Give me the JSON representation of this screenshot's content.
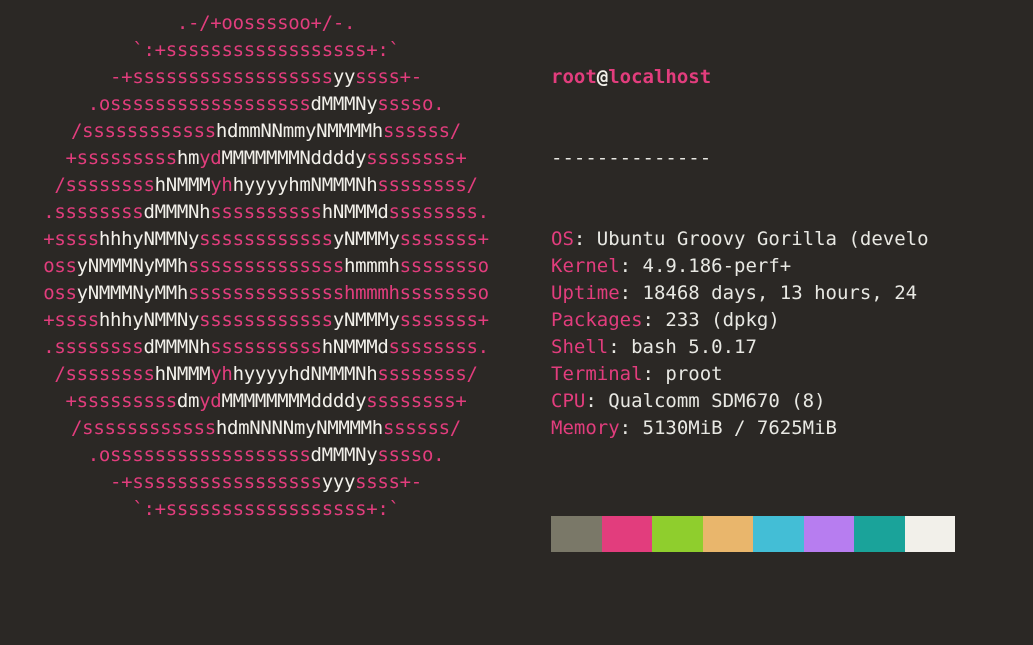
{
  "prompt": {
    "user": "root",
    "at": "@",
    "host": "localhost"
  },
  "divider": "--------------",
  "info": [
    {
      "label": "OS",
      "value": " Ubuntu Groovy Gorilla (develo"
    },
    {
      "label": "Kernel",
      "value": " 4.9.186-perf+"
    },
    {
      "label": "Uptime",
      "value": " 18468 days, 13 hours, 24"
    },
    {
      "label": "Packages",
      "value": " 233 (dpkg)"
    },
    {
      "label": "Shell",
      "value": " bash 5.0.17"
    },
    {
      "label": "Terminal",
      "value": " proot"
    },
    {
      "label": "CPU",
      "value": " Qualcomm SDM670 (8)"
    },
    {
      "label": "Memory",
      "value": " 5130MiB / 7625MiB"
    }
  ],
  "swatches": [
    "#7a7868",
    "#e23d7d",
    "#8fce2d",
    "#e9b66c",
    "#43bed6",
    "#b77df0",
    "#1aa39a",
    "#f2f0ea"
  ],
  "ascii": [
    [
      {
        "c": "p",
        "t": ".-/+oossssoo+/-."
      }
    ],
    [
      {
        "c": "p",
        "t": "`:+ssssssssssssssssss+:`"
      }
    ],
    [
      {
        "c": "p",
        "t": "-+ssssssssssssssssss"
      },
      {
        "c": "w",
        "t": "yy"
      },
      {
        "c": "p",
        "t": "ssss+-"
      }
    ],
    [
      {
        "c": "p",
        "t": ".ossssssssssssssssss"
      },
      {
        "c": "w",
        "t": "dMMMNy"
      },
      {
        "c": "p",
        "t": "sssso."
      }
    ],
    [
      {
        "c": "p",
        "t": "/ssssssssssss"
      },
      {
        "c": "w",
        "t": "hdmmNNmmyNMMMMh"
      },
      {
        "c": "p",
        "t": "ssssss/"
      }
    ],
    [
      {
        "c": "p",
        "t": "+sssssssss"
      },
      {
        "c": "w",
        "t": "hm"
      },
      {
        "c": "p",
        "t": "yd"
      },
      {
        "c": "w",
        "t": "MMMMMMMNddddy"
      },
      {
        "c": "p",
        "t": "ssssssss+"
      }
    ],
    [
      {
        "c": "p",
        "t": "/ssssssss"
      },
      {
        "c": "w",
        "t": "hNMMM"
      },
      {
        "c": "p",
        "t": "yh"
      },
      {
        "c": "w",
        "t": "hyyyyhmNMMMNh"
      },
      {
        "c": "p",
        "t": "ssssssss/"
      }
    ],
    [
      {
        "c": "p",
        "t": ".ssssssss"
      },
      {
        "c": "w",
        "t": "dMMMNh"
      },
      {
        "c": "p",
        "t": "ssssssssss"
      },
      {
        "c": "w",
        "t": "hNMMMd"
      },
      {
        "c": "p",
        "t": "ssssssss."
      }
    ],
    [
      {
        "c": "p",
        "t": "+ssss"
      },
      {
        "c": "w",
        "t": "hhhyNMMNy"
      },
      {
        "c": "p",
        "t": "ssssssssssss"
      },
      {
        "c": "w",
        "t": "yNMMMy"
      },
      {
        "c": "p",
        "t": "sssssss+"
      }
    ],
    [
      {
        "c": "p",
        "t": "oss"
      },
      {
        "c": "w",
        "t": "yNMMMNyMMh"
      },
      {
        "c": "p",
        "t": "ssssssssssssss"
      },
      {
        "c": "w",
        "t": "hmmmh"
      },
      {
        "c": "p",
        "t": "ssssssso"
      }
    ],
    [
      {
        "c": "p",
        "t": "oss"
      },
      {
        "c": "w",
        "t": "yNMMMNyMMh"
      },
      {
        "c": "p",
        "t": "sssssssssssssshmmmhssssssso"
      }
    ],
    [
      {
        "c": "p",
        "t": "+ssss"
      },
      {
        "c": "w",
        "t": "hhhyNMMNy"
      },
      {
        "c": "p",
        "t": "ssssssssssss"
      },
      {
        "c": "w",
        "t": "yNMMMy"
      },
      {
        "c": "p",
        "t": "sssssss+"
      }
    ],
    [
      {
        "c": "p",
        "t": ".ssssssss"
      },
      {
        "c": "w",
        "t": "dMMMNh"
      },
      {
        "c": "p",
        "t": "ssssssssss"
      },
      {
        "c": "w",
        "t": "hNMMMd"
      },
      {
        "c": "p",
        "t": "ssssssss."
      }
    ],
    [
      {
        "c": "p",
        "t": "/ssssssss"
      },
      {
        "c": "w",
        "t": "hNMMM"
      },
      {
        "c": "p",
        "t": "yh"
      },
      {
        "c": "w",
        "t": "hyyyyhdNMMMNh"
      },
      {
        "c": "p",
        "t": "ssssssss/"
      }
    ],
    [
      {
        "c": "p",
        "t": "+sssssssss"
      },
      {
        "c": "w",
        "t": "dm"
      },
      {
        "c": "p",
        "t": "yd"
      },
      {
        "c": "w",
        "t": "MMMMMMMMddddy"
      },
      {
        "c": "p",
        "t": "ssssssss+"
      }
    ],
    [
      {
        "c": "p",
        "t": "/ssssssssssss"
      },
      {
        "c": "w",
        "t": "hdmNNNNmyNMMMMh"
      },
      {
        "c": "p",
        "t": "ssssss/"
      }
    ],
    [
      {
        "c": "p",
        "t": ".ossssssssssssssssss"
      },
      {
        "c": "w",
        "t": "dMMMNy"
      },
      {
        "c": "p",
        "t": "sssso."
      }
    ],
    [
      {
        "c": "p",
        "t": "-+sssssssssssssssss"
      },
      {
        "c": "w",
        "t": "yyy"
      },
      {
        "c": "p",
        "t": "ssss+-"
      }
    ],
    [
      {
        "c": "p",
        "t": "`:+ssssssssssssssssss+:`"
      }
    ]
  ]
}
